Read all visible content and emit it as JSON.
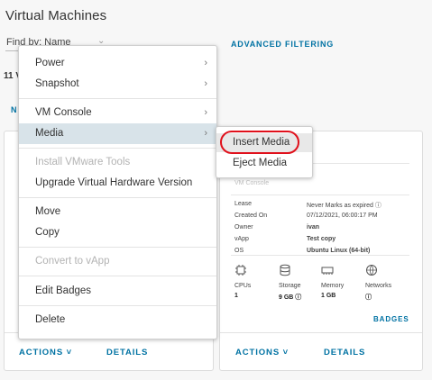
{
  "page": {
    "title": "Virtual Machines"
  },
  "filter": {
    "find_by": "Find by: Name",
    "advanced": "ADVANCED FILTERING"
  },
  "count": "11 V",
  "partial_link": "N",
  "context_menu": {
    "items": [
      {
        "label": "Power",
        "submenu": true
      },
      {
        "label": "Snapshot",
        "submenu": true
      },
      {
        "label": "VM Console",
        "submenu": true
      },
      {
        "label": "Media",
        "submenu": true,
        "active": true
      },
      {
        "label": "Install VMware Tools",
        "disabled": true
      },
      {
        "label": "Upgrade Virtual Hardware Version"
      },
      {
        "label": "Move"
      },
      {
        "label": "Copy"
      },
      {
        "label": "Convert to vApp",
        "disabled": true
      },
      {
        "label": "Edit Badges"
      },
      {
        "label": "Delete"
      }
    ]
  },
  "media_submenu": {
    "insert": "Insert Media",
    "eject": "Eject Media"
  },
  "vm_card": {
    "console_text": "VM Console",
    "details": [
      {
        "label": "Lease",
        "value": "Never Marks as expired ⓘ"
      },
      {
        "label": "Created On",
        "value": "07/12/2021, 06:00:17 PM"
      },
      {
        "label": "Owner",
        "value": "ivan"
      },
      {
        "label": "vApp",
        "value": "Test copy"
      },
      {
        "label": "OS",
        "value": "Ubuntu Linux (64-bit)"
      }
    ],
    "stats": [
      {
        "label": "CPUs",
        "value": "1",
        "icon": "cpu-icon"
      },
      {
        "label": "Storage",
        "value": "9 GB ⓘ",
        "icon": "storage-icon"
      },
      {
        "label": "Memory",
        "value": "1 GB",
        "icon": "memory-icon"
      },
      {
        "label": "Networks",
        "value": "ⓘ",
        "icon": "network-icon"
      }
    ],
    "badges": "BADGES"
  },
  "card_footer": {
    "actions": "ACTIONS ˅",
    "details": "DETAILS"
  },
  "colors": {
    "link": "#0072a3",
    "active_row": "#d8e3e9",
    "highlight_ring": "#e0101b"
  }
}
